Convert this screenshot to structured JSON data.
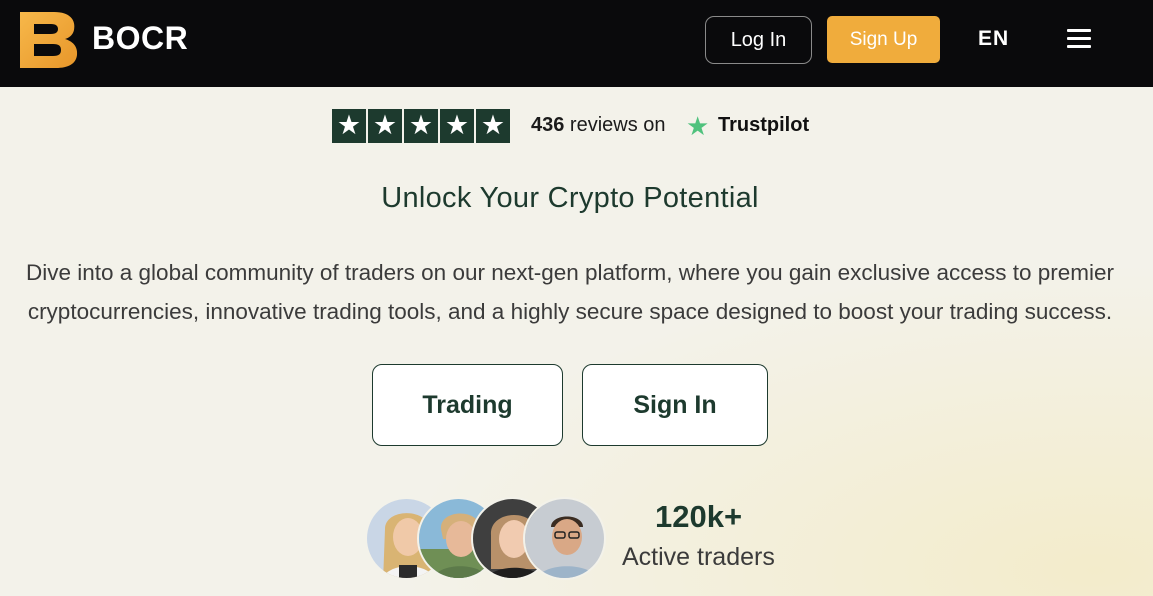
{
  "header": {
    "brand": "BOCR",
    "login_label": "Log In",
    "signup_label": "Sign Up",
    "language": "EN",
    "colors": {
      "background": "#0a0a0c",
      "accent": "#f0ac3c"
    }
  },
  "trustpilot": {
    "rating_stars": 5,
    "review_count": "436",
    "reviews_text": " reviews on",
    "platform": "Trustpilot"
  },
  "hero": {
    "headline": "Unlock Your Crypto Potential",
    "description_line1": "Dive into a global community of traders on our next-gen platform, where you gain exclusive access to premier",
    "description_line2": "cryptocurrencies, innovative trading tools, and a highly secure space designed to boost your trading success.",
    "trading_button": "Trading",
    "signin_button": "Sign In"
  },
  "stats": {
    "value": "120k+",
    "label": "Active traders"
  },
  "icons": [
    "bocr-logo-icon",
    "star-icon",
    "trustpilot-star-icon",
    "hamburger-menu-icon"
  ],
  "colors": {
    "primary": "#1d3a2e",
    "trustpilot_green": "#4fc27d",
    "page_bg": "#f3f2ea"
  }
}
